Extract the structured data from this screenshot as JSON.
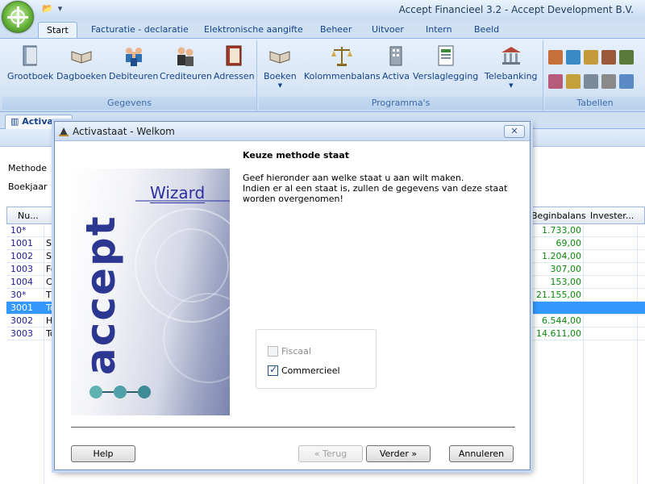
{
  "window": {
    "title": "Accept Financieel 3.2 - Accept Development B.V."
  },
  "tabs": [
    "Start",
    "Facturatie - declaratie",
    "Elektronische aangifte",
    "Beheer",
    "Uitvoer",
    "Intern",
    "Beeld"
  ],
  "ribbon": {
    "groups": [
      {
        "label": "Gegevens",
        "buttons": [
          "Grootboek",
          "Dagboeken",
          "Debiteuren",
          "Crediteuren",
          "Adressen"
        ]
      },
      {
        "label": "Programma's",
        "buttons": [
          "Boeken",
          "Kolommenbalans",
          "Activa",
          "Verslaglegging",
          "Telebanking"
        ]
      },
      {
        "label": "Tabellen",
        "buttons": []
      }
    ]
  },
  "document": {
    "tab_label": "Activa",
    "method_label": "Methode",
    "year_label": "Boekjaar",
    "grid": {
      "headers": [
        "Nu...",
        "Beginbalans",
        "Invester..."
      ],
      "rows": [
        {
          "num": "10*",
          "desc": "",
          "value": "1.733,00",
          "selected": false
        },
        {
          "num": "1001",
          "desc": "So",
          "value": "69,00",
          "selected": false
        },
        {
          "num": "1002",
          "desc": "St",
          "value": "1.204,00",
          "selected": false
        },
        {
          "num": "1003",
          "desc": "Fo",
          "value": "307,00",
          "selected": false
        },
        {
          "num": "1004",
          "desc": "Ca",
          "value": "153,00",
          "selected": false
        },
        {
          "num": "30*",
          "desc": "TR",
          "value": "21.155,00",
          "selected": false
        },
        {
          "num": "3001",
          "desc": "To",
          "value": "",
          "selected": true
        },
        {
          "num": "3002",
          "desc": "H",
          "value": "6.544,00",
          "selected": false
        },
        {
          "num": "3003",
          "desc": "To",
          "value": "14.611,00",
          "selected": false
        }
      ]
    }
  },
  "dialog": {
    "title": "Activastaat - Welkom",
    "side_heading": "Wizard",
    "brand": "accept",
    "heading": "Keuze methode staat",
    "body_line1": "Geef hieronder aan welke staat u aan wilt maken.",
    "body_line2": "Indien er al een staat is, zullen de gegevens van deze staat worden overgenomen!",
    "options": [
      {
        "label": "Fiscaal",
        "checked": false,
        "enabled": false
      },
      {
        "label": "Commercieel",
        "checked": true,
        "enabled": true
      }
    ],
    "buttons": {
      "help": "Help",
      "back": "« Terug",
      "next": "Verder »",
      "cancel": "Annuleren"
    },
    "close_glyph": "✕"
  },
  "colors": {
    "accent": "#15428b",
    "selection": "#3399ff",
    "value_green": "#0a8a0a",
    "number_blue": "#1b1b9b"
  }
}
